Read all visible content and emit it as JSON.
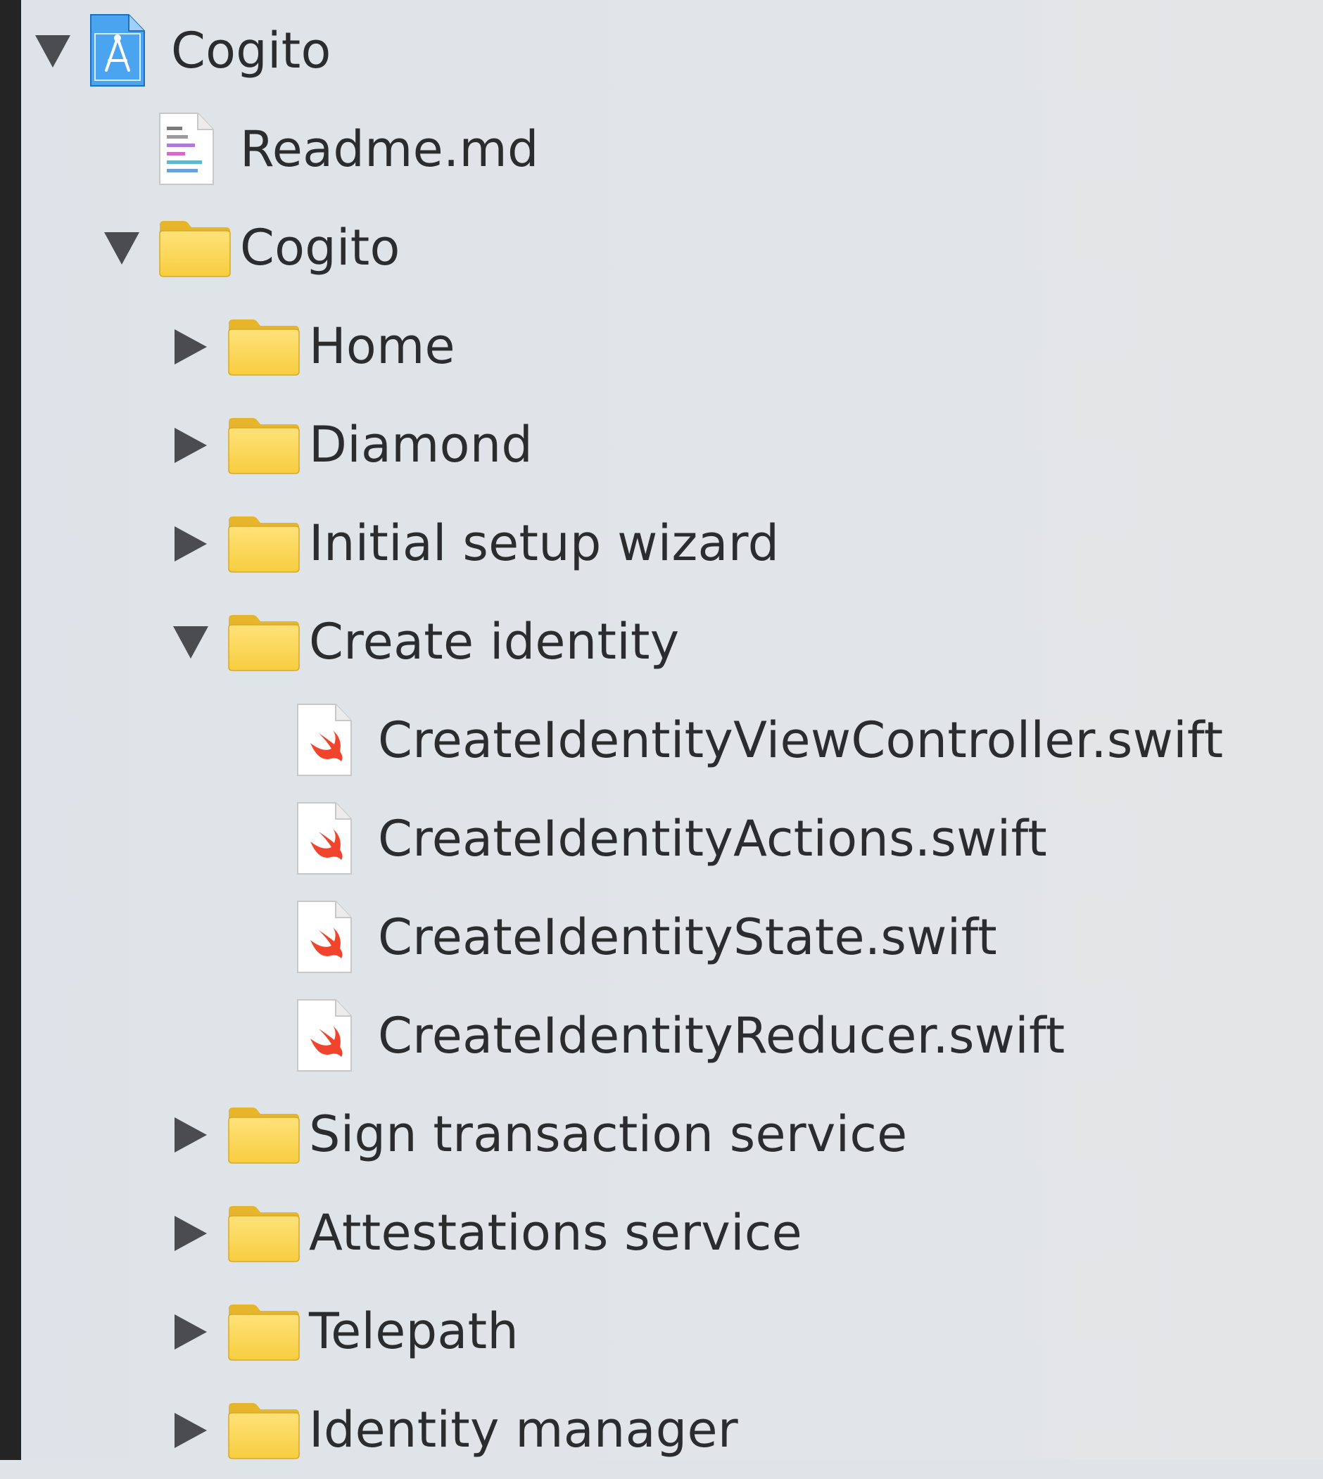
{
  "navigator": {
    "items": [
      {
        "label": "Cogito",
        "kind": "project",
        "depth": 0,
        "disclosure": "expanded",
        "icon": "xcode-project-icon"
      },
      {
        "label": "Readme.md",
        "kind": "markdown-file",
        "depth": 1,
        "disclosure": "none",
        "icon": "markdown-file-icon"
      },
      {
        "label": "Cogito",
        "kind": "folder",
        "depth": 1,
        "disclosure": "expanded",
        "icon": "folder-icon"
      },
      {
        "label": "Home",
        "kind": "folder",
        "depth": 2,
        "disclosure": "collapsed",
        "icon": "folder-icon"
      },
      {
        "label": "Diamond",
        "kind": "folder",
        "depth": 2,
        "disclosure": "collapsed",
        "icon": "folder-icon"
      },
      {
        "label": "Initial setup wizard",
        "kind": "folder",
        "depth": 2,
        "disclosure": "collapsed",
        "icon": "folder-icon"
      },
      {
        "label": "Create identity",
        "kind": "folder",
        "depth": 2,
        "disclosure": "expanded",
        "icon": "folder-icon"
      },
      {
        "label": "CreateIdentityViewController.swift",
        "kind": "swift-file",
        "depth": 3,
        "disclosure": "none",
        "icon": "swift-file-icon"
      },
      {
        "label": "CreateIdentityActions.swift",
        "kind": "swift-file",
        "depth": 3,
        "disclosure": "none",
        "icon": "swift-file-icon"
      },
      {
        "label": "CreateIdentityState.swift",
        "kind": "swift-file",
        "depth": 3,
        "disclosure": "none",
        "icon": "swift-file-icon"
      },
      {
        "label": "CreateIdentityReducer.swift",
        "kind": "swift-file",
        "depth": 3,
        "disclosure": "none",
        "icon": "swift-file-icon"
      },
      {
        "label": "Sign transaction service",
        "kind": "folder",
        "depth": 2,
        "disclosure": "collapsed",
        "icon": "folder-icon"
      },
      {
        "label": "Attestations service",
        "kind": "folder",
        "depth": 2,
        "disclosure": "collapsed",
        "icon": "folder-icon"
      },
      {
        "label": "Telepath",
        "kind": "folder",
        "depth": 2,
        "disclosure": "collapsed",
        "icon": "folder-icon"
      },
      {
        "label": "Identity manager",
        "kind": "folder",
        "depth": 2,
        "disclosure": "collapsed",
        "icon": "folder-icon"
      }
    ]
  },
  "colors": {
    "background": "#dfe4e8",
    "text": "#2b2c2e",
    "disclosure": "#4a4c50",
    "folder": "#f7cd3f",
    "swift": "#f0452c",
    "project": "#2f8de4"
  }
}
